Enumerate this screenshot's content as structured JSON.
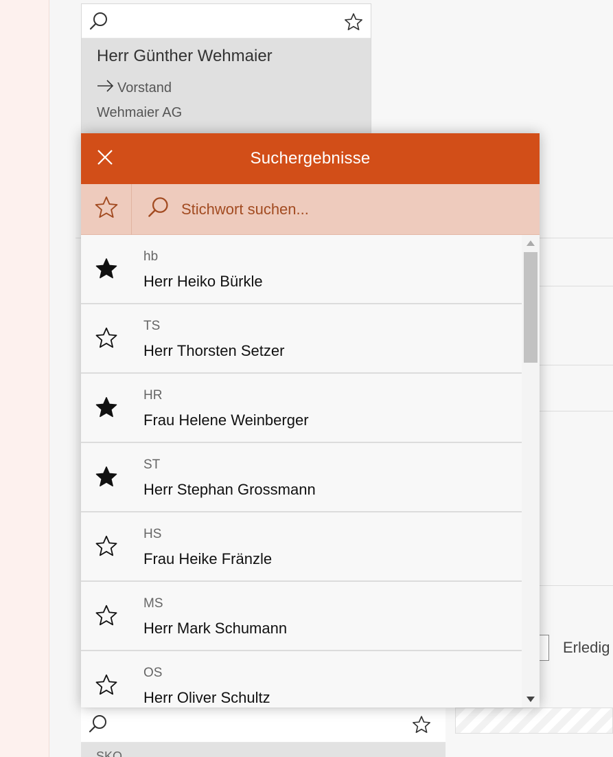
{
  "background": {
    "trailing_label": "Erledig"
  },
  "top_card": {
    "salutation": "Herr",
    "given_name": "Günther Wehmaier",
    "role": "Vorstand",
    "company": "Wehmaier AG"
  },
  "bottom_card": {
    "partial_text": "SKO"
  },
  "modal": {
    "title": "Suchergebnisse",
    "search_placeholder": "Stichwort suchen...",
    "accent_color": "#d24e18",
    "filter_bar_color": "#eecbbd"
  },
  "results": [
    {
      "abbr": "hb",
      "salutation": "Herr",
      "name": "Heiko Bürkle",
      "favorite": true
    },
    {
      "abbr": "TS",
      "salutation": "Herr",
      "name": "Thorsten Setzer",
      "favorite": false
    },
    {
      "abbr": "HR",
      "salutation": "Frau",
      "name": "Helene Weinberger",
      "favorite": true
    },
    {
      "abbr": "ST",
      "salutation": "Herr",
      "name": "Stephan Grossmann",
      "favorite": true
    },
    {
      "abbr": "HS",
      "salutation": "Frau",
      "name": "Heike Fränzle",
      "favorite": false
    },
    {
      "abbr": "MS",
      "salutation": "Herr",
      "name": "Mark Schumann",
      "favorite": false
    },
    {
      "abbr": "OS",
      "salutation": "Herr",
      "name": "Oliver Schultz",
      "favorite": false
    }
  ]
}
